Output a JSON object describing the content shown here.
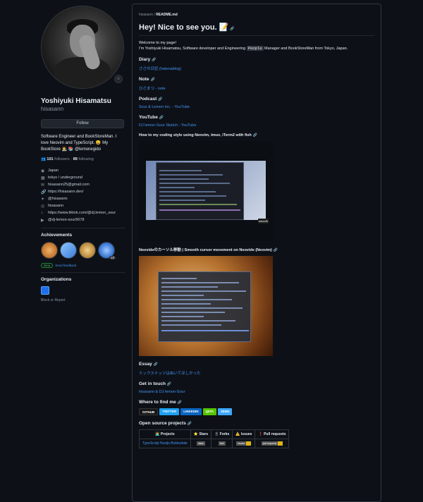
{
  "profile": {
    "name": "Yoshiyuki Hisamatsu",
    "login": "hisasann",
    "follow_label": "Follow",
    "bio": "Software Engineer and BookStoreMan. I love Neovim and TypeScript. 😄 My BookStore 🧑‍🎨 📚 @lemonegido",
    "followers_count": "101",
    "followers_label": "followers",
    "following_count": "89",
    "following_label": "following",
    "details": [
      {
        "icon": "globe-icon",
        "text": "Japan"
      },
      {
        "icon": "building-icon",
        "text": "tokyo / underground"
      },
      {
        "icon": "mail-icon",
        "text": "hisasann25@gmail.com"
      },
      {
        "icon": "link-icon",
        "text": "https://hisasann.dev/"
      },
      {
        "icon": "twitter-icon",
        "text": "@hisasann"
      },
      {
        "icon": "instagram-icon",
        "text": "hisasann"
      },
      {
        "icon": "tiktok-icon",
        "text": "https://www.tiktok.com/@dj.lemon_sour"
      },
      {
        "icon": "youtube-icon",
        "text": "@dj-lemon-sour5678"
      }
    ],
    "achievements_title": "Achievements",
    "achievement_more": "x3",
    "beta_label": "Beta",
    "feedback_label": "Send feedback",
    "organizations_title": "Organizations",
    "block_label": "Block or Report"
  },
  "readme": {
    "path_user": "hisasann",
    "path_file": "README.md",
    "title": "Hey! Nice to see you. 📝",
    "welcome": "Welcome to my page!",
    "intro_before": "I'm Yoshiyuki Hisamatsu, Software developer and Engineering",
    "intro_code": "People",
    "intro_after": "Manager and BookStoreMan from Tokyo, Japan.",
    "diary_title": "Diary",
    "diary_link": "ささの日記 (hatenablog)",
    "note_title": "Note",
    "note_link": "ひさまつ - note",
    "podcast_title": "Podcast",
    "podcast_link": "Sour & Lemon Inc. - YouTube",
    "youtube_title": "YouTube",
    "youtube_link": "DJ lemon-Sour Sketch - YouTube",
    "video1_title": "How to my coding style using Neovim, tmux, iTerm2 with fish",
    "video1_logo": "smooth",
    "video2_title": "Neovideのカーソル移動 | Smooth cursor movement on Neovide (Neovim)",
    "essay_title": "Essay",
    "essay_link": "ミックスナッツはぬいてほしかった",
    "contact_title": "Get in touch",
    "contact_link": "hisasann & DJ lemon-Sour",
    "where_title": "Where to find me",
    "shields": [
      "GITHUB",
      "TWITTER",
      "LINKEDIN",
      "QIITA",
      "ZENN"
    ],
    "oss_title": "Open source projects",
    "table_headers": [
      "🧑‍💻 Projects",
      "⭐ Stars",
      "🍴 Forks",
      "⚠️ Issues",
      "❗ Pull requests"
    ],
    "table_row": {
      "project": "TypeScript Nuxtjs Boilerplate",
      "stars_label": "stars",
      "forks_label": "fork",
      "issues_label": "issues",
      "prs_label": "pull requests"
    }
  }
}
